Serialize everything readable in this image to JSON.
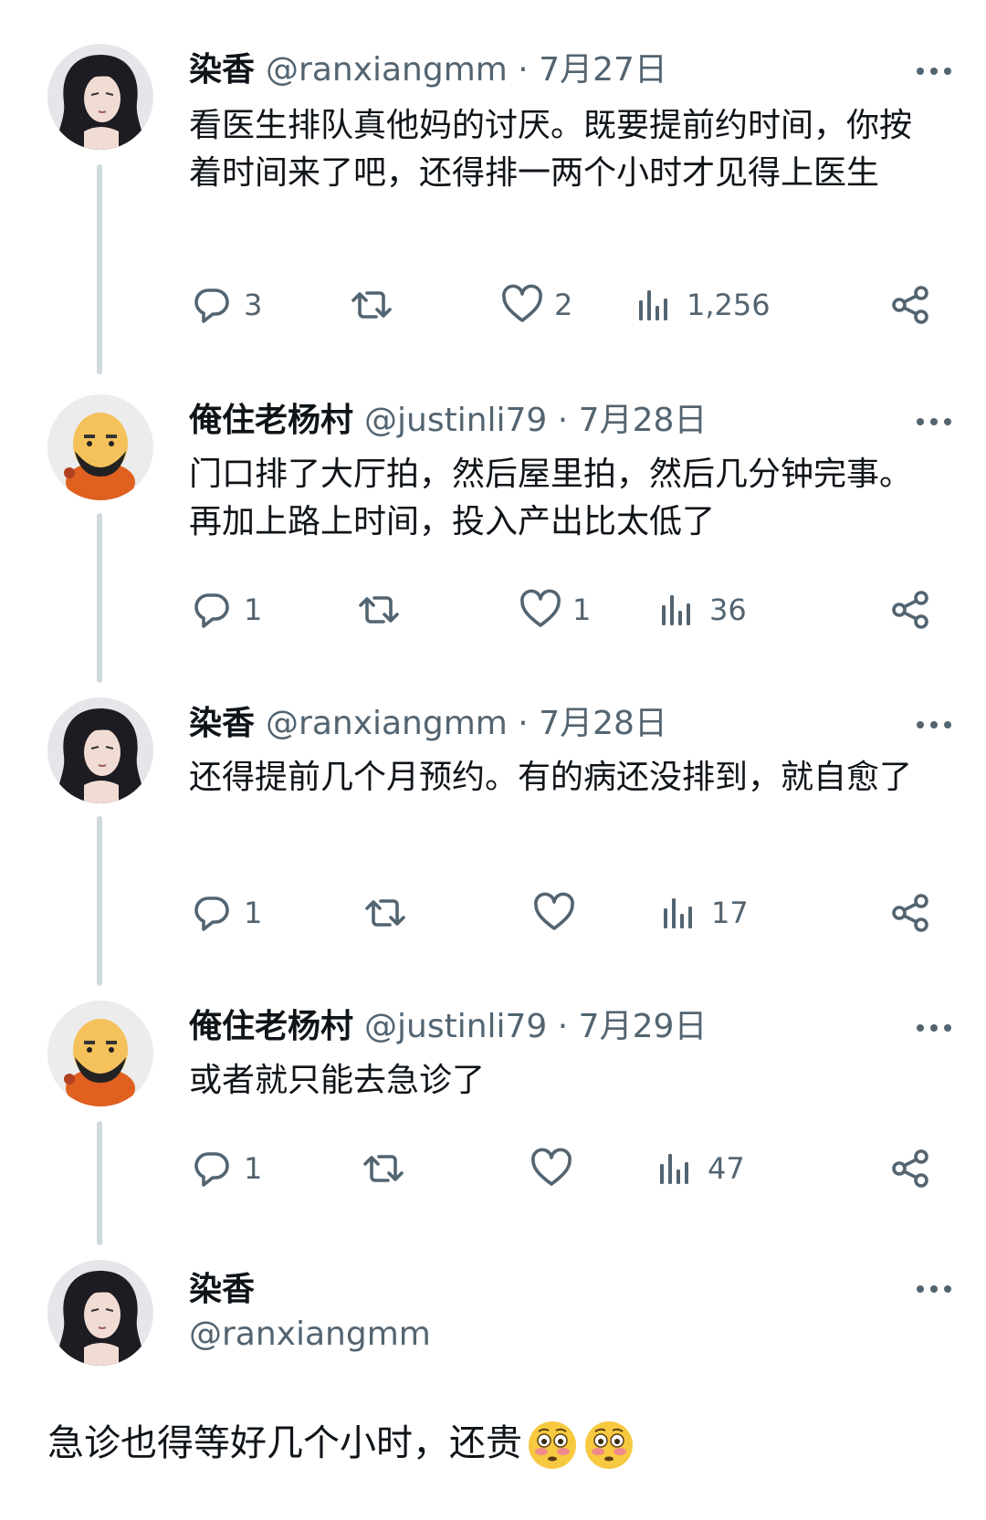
{
  "tweets": [
    {
      "name": "染香",
      "handle": "@ranxiangmm",
      "date": "7月27日",
      "meta": "@ranxiangmm · 7月27日",
      "text": "看医生排队真他妈的讨厌。既要提前约时间，你按着时间来了吧，还得排一两个小时才见得上医生",
      "replies": "3",
      "retweets": "",
      "likes": "2",
      "views": "1,256"
    },
    {
      "name": "俺住老杨村",
      "handle": "@justinli79",
      "date": "7月28日",
      "meta": "@justinli79 · 7月28日",
      "text": "门口排了大厅拍，然后屋里拍，然后几分钟完事。再加上路上时间，投入产出比太低了",
      "replies": "1",
      "retweets": "",
      "likes": "1",
      "views": "36"
    },
    {
      "name": "染香",
      "handle": "@ranxiangmm",
      "date": "7月28日",
      "meta": "@ranxiangmm · 7月28日",
      "text": "还得提前几个月预约。有的病还没排到，就自愈了",
      "replies": "1",
      "retweets": "",
      "likes": "",
      "views": "17"
    },
    {
      "name": "俺住老杨村",
      "handle": "@justinli79",
      "date": "7月29日",
      "meta": "@justinli79 · 7月29日",
      "text": "或者就只能去急诊了",
      "replies": "1",
      "retweets": "",
      "likes": "",
      "views": "47"
    }
  ],
  "main_tweet": {
    "name": "染香",
    "handle": "@ranxiangmm",
    "text": "急诊也得等好几个小时，还贵",
    "emoji": [
      "flushed-face",
      "flushed-face"
    ]
  },
  "icons": {
    "reply": "reply-icon",
    "retweet": "retweet-icon",
    "like": "heart-icon",
    "views": "views-icon",
    "share": "share-icon",
    "more": "more-icon"
  },
  "colors": {
    "text": "#0f1419",
    "secondary": "#536471",
    "thread_line": "#cfd9de",
    "background": "#ffffff"
  }
}
